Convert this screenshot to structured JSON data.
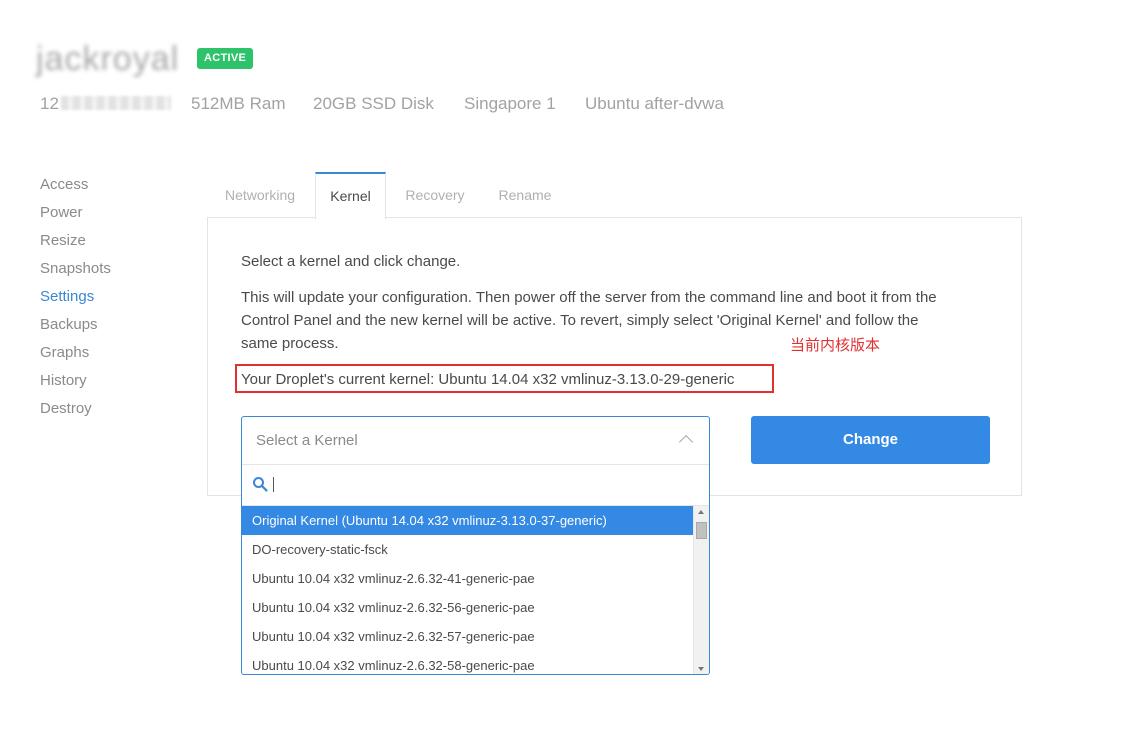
{
  "header": {
    "droplet_name": "jackroyal",
    "status": "ACTIVE",
    "ip_prefix": "12",
    "ram": "512MB Ram",
    "disk": "20GB SSD Disk",
    "region": "Singapore 1",
    "image": "Ubuntu after-dvwa"
  },
  "nav": {
    "items": [
      {
        "label": "Access"
      },
      {
        "label": "Power"
      },
      {
        "label": "Resize"
      },
      {
        "label": "Snapshots"
      },
      {
        "label": "Settings"
      },
      {
        "label": "Backups"
      },
      {
        "label": "Graphs"
      },
      {
        "label": "History"
      },
      {
        "label": "Destroy"
      }
    ],
    "active": "Settings"
  },
  "tabs": [
    {
      "label": "Networking"
    },
    {
      "label": "Kernel"
    },
    {
      "label": "Recovery"
    },
    {
      "label": "Rename"
    }
  ],
  "active_tab": "Kernel",
  "kernel": {
    "intro": "Select a kernel and click change.",
    "description_lines": [
      "This will update your configuration. Then power off the server from the command line and boot it from the",
      "Control Panel and the new kernel will be active. To revert, simply select 'Original Kernel' and follow the",
      "same process."
    ],
    "current_kernel": "Your Droplet's current kernel: Ubuntu 14.04 x32 vmlinuz-3.13.0-29-generic",
    "annotation": "当前内核版本",
    "select_placeholder": "Select a Kernel",
    "search_value": "",
    "change_label": "Change",
    "options": [
      "Original Kernel (Ubuntu 14.04 x32 vmlinuz-3.13.0-37-generic)",
      "DO-recovery-static-fsck",
      "Ubuntu 10.04 x32 vmlinuz-2.6.32-41-generic-pae",
      "Ubuntu 10.04 x32 vmlinuz-2.6.32-56-generic-pae",
      "Ubuntu 10.04 x32 vmlinuz-2.6.32-57-generic-pae",
      "Ubuntu 10.04 x32 vmlinuz-2.6.32-58-generic-pae"
    ],
    "selected_option": "Original Kernel (Ubuntu 14.04 x32 vmlinuz-3.13.0-37-generic)"
  },
  "colors": {
    "accent": "#3389e4",
    "active_badge": "#2ec36b",
    "annotation": "#e03030",
    "nav_active": "#3a87d7"
  },
  "icons": {
    "search": "search-icon",
    "dropdown": "chevron-up-icon"
  }
}
